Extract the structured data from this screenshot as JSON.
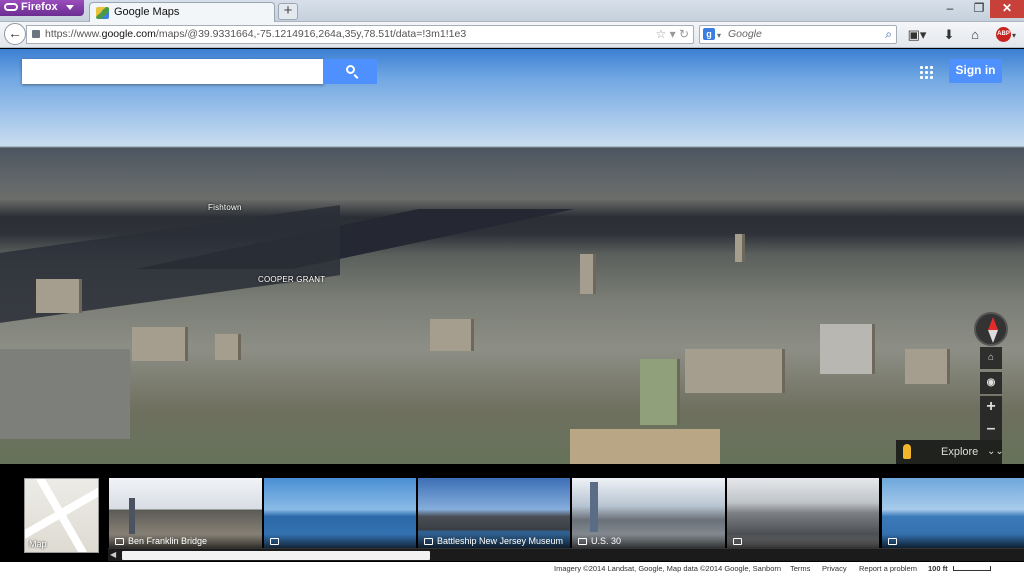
{
  "browser": {
    "app_button": "Firefox",
    "tab_title": "Google Maps",
    "new_tab": "+",
    "url_prefix": "https://www.",
    "url_domain": "google.com",
    "url_path": "/maps/@39.9331664,-75.1214916,264a,35y,78.51t/data=!3m1!1e3",
    "search_engine_badge": "g",
    "search_placeholder": "Google",
    "addon_badge": "ABP",
    "window_controls": {
      "minimize": "–",
      "maximize": "❐",
      "close": "✕"
    },
    "icons": [
      "back-arrow-icon",
      "lock-icon",
      "star-icon",
      "reload-icon",
      "search-magnifier-icon",
      "bookmarks-icon",
      "download-icon",
      "home-icon",
      "adblock-icon"
    ]
  },
  "maps": {
    "search": {
      "placeholder": "",
      "button_icon": "search-icon"
    },
    "signin_label": "Sign in",
    "place_labels": [
      "Fishtown",
      "COOPER GRANT"
    ],
    "controls": {
      "zoom_in": "+",
      "zoom_out": "–"
    },
    "explore_label": "Explore"
  },
  "photo_strip": {
    "map_thumb_label": "Map",
    "photos": [
      {
        "caption": "Ben Franklin Bridge"
      },
      {
        "caption": ""
      },
      {
        "caption": "Battleship New Jersey Museum"
      },
      {
        "caption": "U.S. 30"
      },
      {
        "caption": ""
      },
      {
        "caption": ""
      }
    ]
  },
  "footer": {
    "imagery": "Imagery ©2014 Landsat, Google, Map data ©2014 Google, Sanborn",
    "terms": "Terms",
    "privacy": "Privacy",
    "report": "Report a problem",
    "scale": "100 ft"
  },
  "colors": {
    "google_blue": "#4d90fe",
    "firefox_purple": "#7a3ca0",
    "close_red": "#c7413a"
  }
}
